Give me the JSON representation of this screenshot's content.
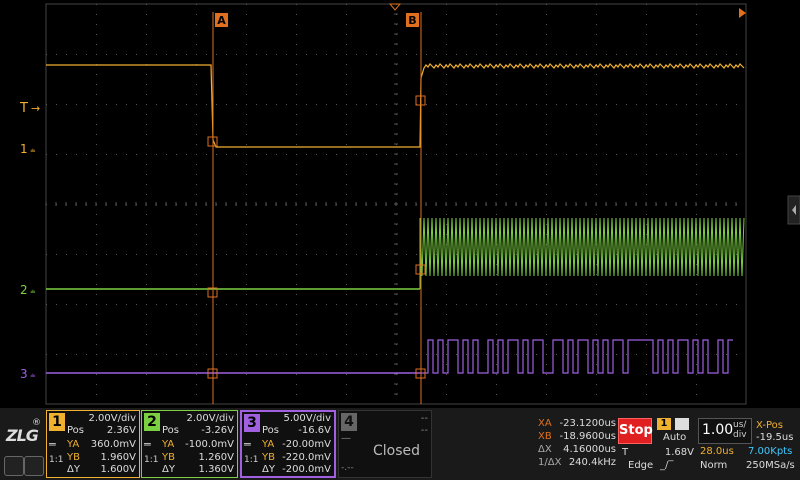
{
  "markers": {
    "cursor_a": "A",
    "cursor_b": "B",
    "trigger_level": "T",
    "ch1_ground": "1",
    "ch2_ground": "2",
    "ch3_ground": "3"
  },
  "brand": {
    "logo_text": "ZLG",
    "registered": "®"
  },
  "channels": [
    {
      "num": "1",
      "scale": "2.00V/div",
      "pos_label": "Pos",
      "pos": "2.36V",
      "ya_label": "YA",
      "ya": "360.0mV",
      "yb_label": "YB",
      "yb": "1.960V",
      "dy_label": "ΔY",
      "dy": "1.600V",
      "coupling": "1:1",
      "color": "#f0b030"
    },
    {
      "num": "2",
      "scale": "2.00V/div",
      "pos_label": "Pos",
      "pos": "-3.26V",
      "ya_label": "YA",
      "ya": "-100.0mV",
      "yb_label": "YB",
      "yb": "1.260V",
      "dy_label": "ΔY",
      "dy": "1.360V",
      "coupling": "1:1",
      "color": "#7ad040"
    },
    {
      "num": "3",
      "scale": "5.00V/div",
      "pos_label": "Pos",
      "pos": "-16.6V",
      "ya_label": "YA",
      "ya": "-20.00mV",
      "yb_label": "YB",
      "yb": "-220.0mV",
      "dy_label": "ΔY",
      "dy": "-200.0mV",
      "coupling": "1:1",
      "color": "#a060e0"
    },
    {
      "num": "4",
      "status": "Closed",
      "dash1": "--",
      "dash2": "--",
      "dash3": "-.--",
      "color": "#808080"
    }
  ],
  "cursors": {
    "xa_label": "XA",
    "xa": "-23.1200us",
    "xb_label": "XB",
    "xb": "-18.9600us",
    "dx_label": "ΔX",
    "dx": "4.16000us",
    "inv_label": "1/ΔX",
    "inv": "240.4kHz"
  },
  "run": {
    "state": "Stop"
  },
  "trigger": {
    "source": "1",
    "mode": "Auto",
    "t_label": "T",
    "level": "1.68V",
    "type": "Edge"
  },
  "timebase": {
    "scale": "1.00",
    "unit_top": "us/",
    "unit_bottom": "div",
    "delay": "28.0us",
    "mode": "Norm"
  },
  "xpos": {
    "label": "X-Pos",
    "value": "-19.5us",
    "points": "7.00Kpts",
    "rate": "250MSa/s"
  },
  "colors": {
    "ch1": "#f0b030",
    "ch2": "#7ad040",
    "ch3": "#a060e0",
    "cursor": "#e07020",
    "grid": "#555555",
    "stop": "#e02020"
  }
}
